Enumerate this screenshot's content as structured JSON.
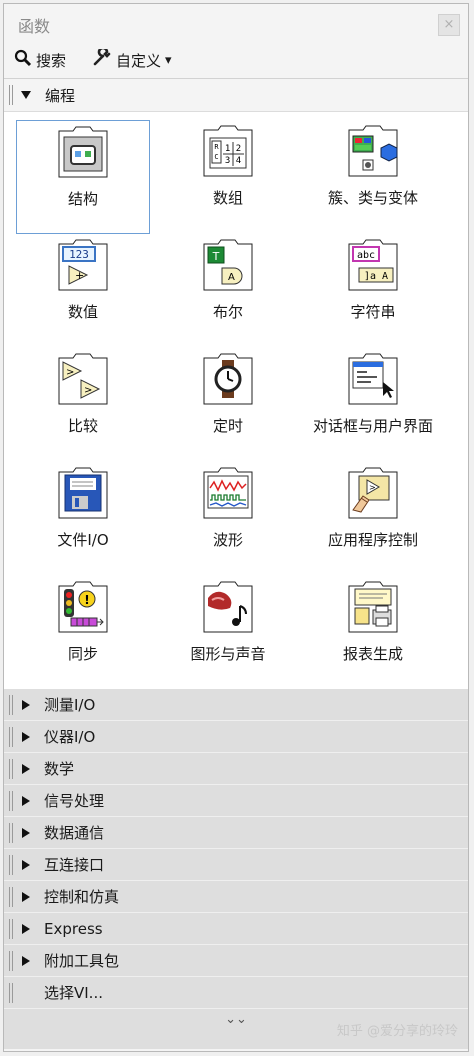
{
  "window": {
    "title": "函数",
    "close_glyph": "×"
  },
  "toolbar": {
    "search_label": "搜索",
    "customize_label": "自定义",
    "dropdown_glyph": "▾"
  },
  "programming": {
    "label": "编程",
    "items": [
      {
        "label": "结构",
        "icon": "structures-icon"
      },
      {
        "label": "数组",
        "icon": "array-icon"
      },
      {
        "label": "簇、类与变体",
        "icon": "cluster-class-variant-icon"
      },
      {
        "label": "数值",
        "icon": "numeric-icon"
      },
      {
        "label": "布尔",
        "icon": "boolean-icon"
      },
      {
        "label": "字符串",
        "icon": "string-icon"
      },
      {
        "label": "比较",
        "icon": "comparison-icon"
      },
      {
        "label": "定时",
        "icon": "timing-icon"
      },
      {
        "label": "对话框与用户界面",
        "icon": "dialog-ui-icon"
      },
      {
        "label": "文件I/O",
        "icon": "file-io-icon"
      },
      {
        "label": "波形",
        "icon": "waveform-icon"
      },
      {
        "label": "应用程序控制",
        "icon": "application-control-icon"
      },
      {
        "label": "同步",
        "icon": "synchronization-icon"
      },
      {
        "label": "图形与声音",
        "icon": "graphics-sound-icon"
      },
      {
        "label": "报表生成",
        "icon": "report-generation-icon"
      }
    ]
  },
  "categories": [
    {
      "label": "测量I/O"
    },
    {
      "label": "仪器I/O"
    },
    {
      "label": "数学"
    },
    {
      "label": "信号处理"
    },
    {
      "label": "数据通信"
    },
    {
      "label": "互连接口"
    },
    {
      "label": "控制和仿真"
    },
    {
      "label": "Express"
    },
    {
      "label": "附加工具包"
    }
  ],
  "select_vi": {
    "label": "选择VI..."
  },
  "expand_glyph": "⌄⌄",
  "watermark": "知乎 @爱分享的玲玲"
}
